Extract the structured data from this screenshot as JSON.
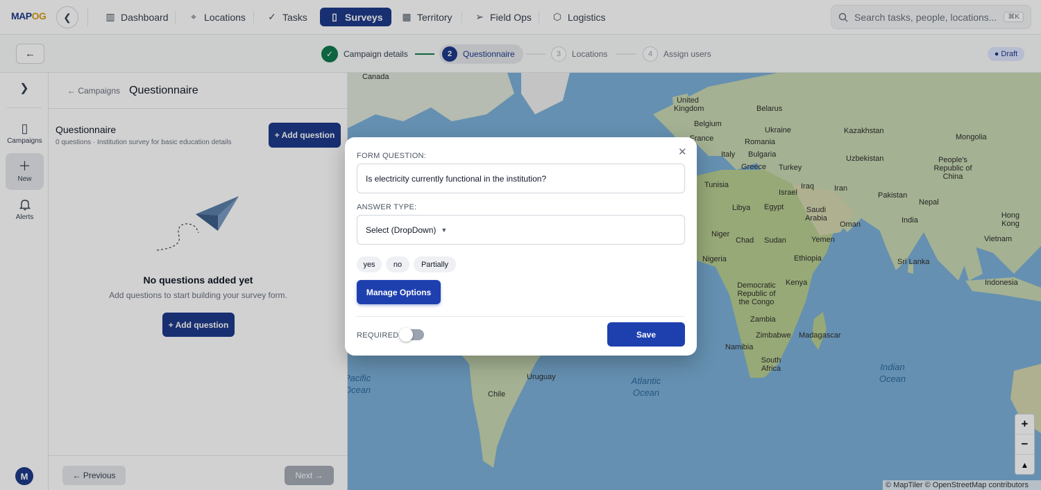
{
  "app": {
    "logo_prefix": "MAP",
    "logo_suffix": "OG"
  },
  "nav": {
    "items": [
      {
        "label": "Dashboard",
        "icon": "bar-chart-icon"
      },
      {
        "label": "Locations",
        "icon": "map-pin-icon"
      },
      {
        "label": "Tasks",
        "icon": "check-icon"
      },
      {
        "label": "Surveys",
        "icon": "clipboard-icon",
        "active": true
      },
      {
        "label": "Territory",
        "icon": "map-icon"
      },
      {
        "label": "Field Ops",
        "icon": "send-icon"
      },
      {
        "label": "Logistics",
        "icon": "box-icon"
      }
    ],
    "search_placeholder": "Search tasks, people, locations...",
    "search_shortcut": "⌘K"
  },
  "stepper": {
    "steps": [
      {
        "num": "✓",
        "label": "Campaign details",
        "state": "done"
      },
      {
        "num": "2",
        "label": "Questionnaire",
        "state": "current"
      },
      {
        "num": "3",
        "label": "Locations",
        "state": "pending"
      },
      {
        "num": "4",
        "label": "Assign users",
        "state": "pending"
      }
    ],
    "status_badge": "Draft"
  },
  "rail": {
    "items": [
      {
        "label": "Campaigns",
        "icon": "clipboard-icon"
      },
      {
        "label": "New",
        "icon": "plus-icon",
        "active": true
      },
      {
        "label": "Alerts",
        "icon": "bell-icon"
      }
    ],
    "avatar_initial": "M"
  },
  "panel": {
    "back_link": "← Campaigns",
    "title": "Questionnaire",
    "section_title": "Questionnaire",
    "section_subtitle": "0 questions · Institution survey for basic education details",
    "add_question_top": "+ Add question",
    "empty_title": "No questions added yet",
    "empty_subtitle": "Add questions to start building your survey form.",
    "add_question_center": "+ Add question",
    "previous": "← Previous",
    "next": "Next →"
  },
  "map": {
    "labels": {
      "canada": "Canada",
      "uk": "United Kingdom",
      "belarus": "Belarus",
      "belgium": "Belgium",
      "ukraine": "Ukraine",
      "france": "France",
      "kazakhstan": "Kazakhstan",
      "mongolia": "Mongolia",
      "romania": "Romania",
      "italy": "Italy",
      "bulgaria": "Bulgaria",
      "uzbekistan": "Uzbekistan",
      "greece": "Greece",
      "turkey": "Turkey",
      "china": "People's Republic of China",
      "tunisia": "Tunisia",
      "israel": "Israel",
      "iraq": "Iraq",
      "iran": "Iran",
      "pakistan": "Pakistan",
      "nepal": "Nepal",
      "libya": "Libya",
      "egypt": "Egypt",
      "saudi": "Saudi Arabia",
      "india": "India",
      "hongkong": "Hong Kong",
      "oman": "Oman",
      "niger": "Niger",
      "chad": "Chad",
      "sudan": "Sudan",
      "yemen": "Yemen",
      "vietnam": "Vietnam",
      "nigeria": "Nigeria",
      "ethiopia": "Ethiopia",
      "srilanka": "Sri Lanka",
      "drc": "Democratic Republic of the Congo",
      "kenya": "Kenya",
      "indonesia": "Indonesia",
      "zambia": "Zambia",
      "zimbabwe": "Zimbabwe",
      "madagascar": "Madagascar",
      "namibia": "Namibia",
      "southafrica": "South Africa",
      "uruguay": "Uruguay",
      "chile": "Chile",
      "atlantic": "Atlantic Ocean",
      "indian": "Indian Ocean",
      "pacific": "Pacific Ocean"
    },
    "zoom_in": "+",
    "zoom_out": "−",
    "compass": "▲",
    "attribution": "© MapTiler © OpenStreetMap contributors"
  },
  "modal": {
    "question_label": "FORM QUESTION:",
    "question_value": "Is electricity currently functional in the institution?",
    "answer_type_label": "ANSWER TYPE:",
    "answer_type_value": "Select (DropDown)",
    "options": [
      "yes",
      "no",
      "Partially"
    ],
    "manage_options": "Manage Options",
    "required_label": "REQUIRED",
    "required_value": false,
    "save": "Save",
    "close": "✕"
  },
  "colors": {
    "primary": "#1e3a8a",
    "accent_button": "#1e40af",
    "success": "#0f7a4f",
    "map_water": "#7cb0d8",
    "map_land": "#c9d8b2"
  }
}
